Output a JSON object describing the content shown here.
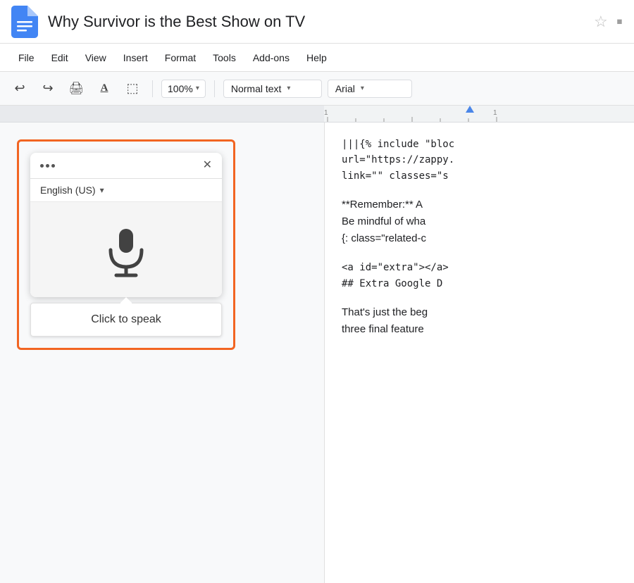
{
  "titleBar": {
    "title": "Why Survivor is the Best Show on TV",
    "starLabel": "★",
    "folderLabel": "▪"
  },
  "menuBar": {
    "items": [
      "File",
      "Edit",
      "View",
      "Insert",
      "Format",
      "Tools",
      "Add-ons",
      "Help"
    ]
  },
  "toolbar": {
    "undo": "↩",
    "redo": "↪",
    "print": "🖨",
    "spellcheck": "A",
    "paintFormat": "▸",
    "zoom": "100%",
    "zoomDropdown": "▾",
    "style": "Normal text",
    "styleDropdown": "▾",
    "font": "Arial",
    "fontDropdown": "▾"
  },
  "voiceWidget": {
    "languageLabel": "English (US)",
    "clickToSpeakLabel": "Click to speak"
  },
  "docContent": {
    "line1": "|||{% include \"bloc",
    "line2": "url=\"https://zappy.",
    "line3": "link=\"\" classes=\"s",
    "line4": "**Remember:** A",
    "line5": "Be mindful of wha",
    "line6": "{: class=\"related-c",
    "line7": "<a id=\"extra\"></a>",
    "line8": "## Extra Google D",
    "line9": "That's just the beg",
    "line10": "three final feature"
  },
  "icons": {
    "dotsMenu": "···",
    "closeBtn": "✕",
    "chevronDown": "▾"
  }
}
